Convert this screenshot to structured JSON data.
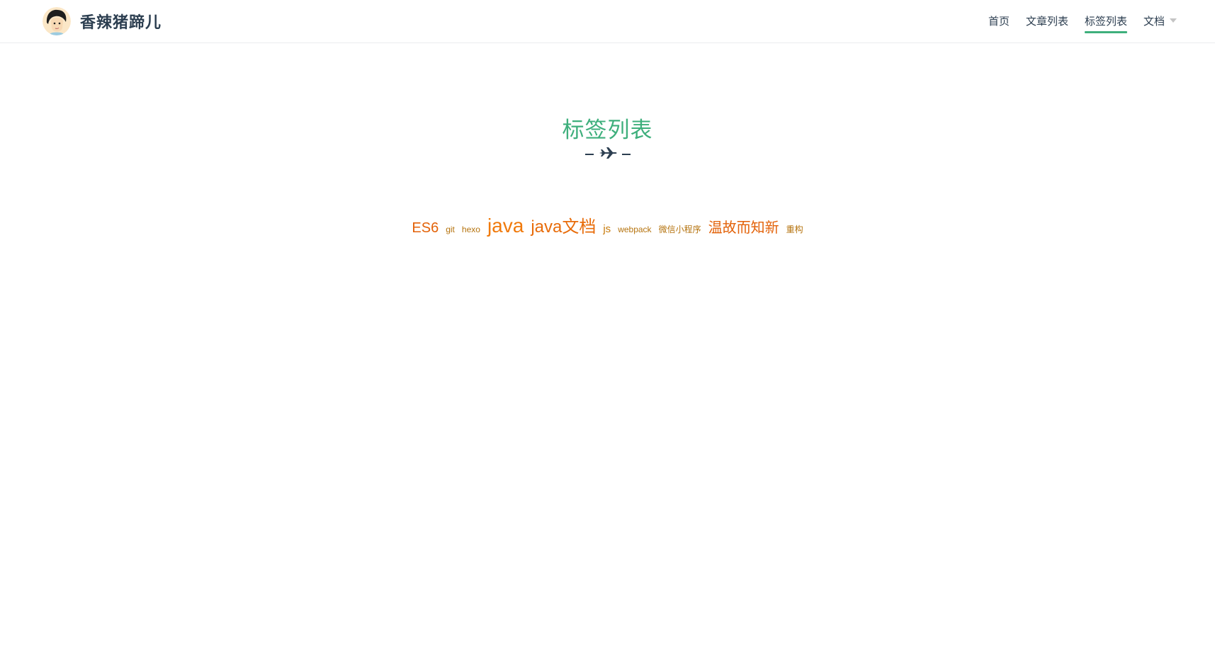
{
  "header": {
    "site_title": "香辣猪蹄儿",
    "nav": [
      {
        "label": "首页"
      },
      {
        "label": "文章列表"
      },
      {
        "label": "标签列表",
        "active": true
      },
      {
        "label": "文档",
        "dropdown": true
      }
    ]
  },
  "main": {
    "title": "标签列表",
    "divider_icon": "airplane-icon",
    "tags": [
      {
        "label": "ES6",
        "weight": 3,
        "color": "#e36209"
      },
      {
        "label": "git",
        "weight": 1,
        "color": "#b5730e"
      },
      {
        "label": "hexo",
        "weight": 1,
        "color": "#b5730e"
      },
      {
        "label": "java",
        "weight": 5,
        "color": "#f07a0c"
      },
      {
        "label": "java文档",
        "weight": 4,
        "color": "#e86c0a"
      },
      {
        "label": "js",
        "weight": 2,
        "color": "#c77a0a"
      },
      {
        "label": "webpack",
        "weight": 1,
        "color": "#b5730e"
      },
      {
        "label": "微信小程序",
        "weight": 1,
        "color": "#b5730e"
      },
      {
        "label": "温故而知新",
        "weight": 3,
        "color": "#e36209"
      },
      {
        "label": "重构",
        "weight": 1,
        "color": "#b5730e"
      }
    ]
  },
  "colors": {
    "accent": "#3eaf7c",
    "text": "#2c3e50"
  }
}
